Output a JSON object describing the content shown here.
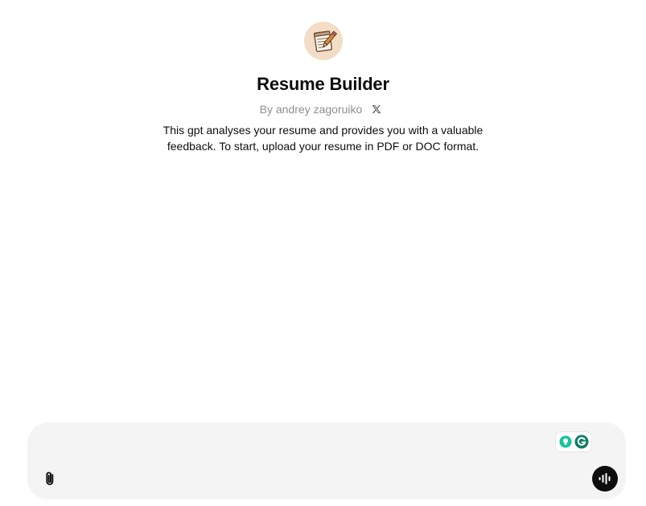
{
  "gpt": {
    "avatar_icon": "notepad-pencil-icon",
    "name": "Resume Builder",
    "byline": "By andrey zagoruiko",
    "social_icon": "x-logo-icon",
    "description": "This gpt analyses your resume and provides you with a valuable feedback. To start, upload your resume in PDF or DOC format."
  },
  "composer": {
    "input_value": "",
    "placeholder": "",
    "attach_icon": "paperclip-icon",
    "voice_icon": "voice-waveform-icon",
    "extension_icons": [
      "lightbulb-icon",
      "grammarly-icon"
    ]
  },
  "colors": {
    "composer_bg": "#f4f4f4",
    "voice_button_bg": "#0d0d0d",
    "grammarly_green": "#15c39a",
    "grammarly_dark": "#0e7c66"
  }
}
